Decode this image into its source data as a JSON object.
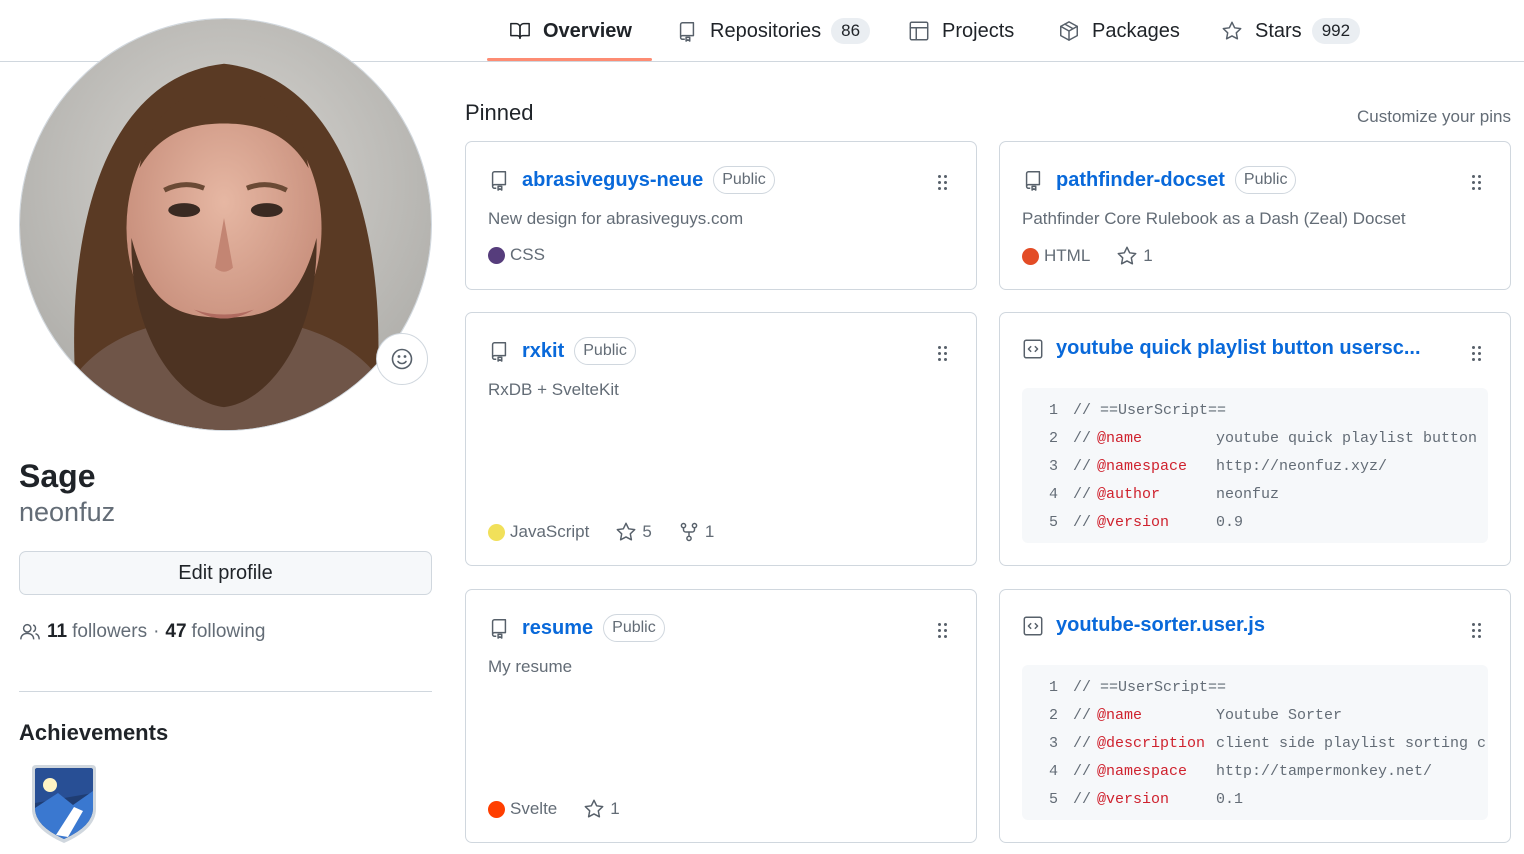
{
  "nav": {
    "tabs": [
      {
        "label": "Overview",
        "icon": "book-icon",
        "active": true
      },
      {
        "label": "Repositories",
        "icon": "repo-icon",
        "count": "86"
      },
      {
        "label": "Projects",
        "icon": "table-icon"
      },
      {
        "label": "Packages",
        "icon": "package-icon"
      },
      {
        "label": "Stars",
        "icon": "star-icon",
        "count": "992"
      }
    ],
    "active_color": "#fd8c73"
  },
  "profile": {
    "display_name": "Sage",
    "username": "neonfuz",
    "edit_label": "Edit profile",
    "followers_count": "11",
    "followers_label": "followers",
    "separator": "·",
    "following_count": "47",
    "following_label": "following",
    "achievements_title": "Achievements"
  },
  "pinned": {
    "title": "Pinned",
    "customize_label": "Customize your pins",
    "cards": [
      {
        "name": "abrasiveguys-neue",
        "visibility": "Public",
        "description": "New design for abrasiveguys.com",
        "language": "CSS",
        "language_color": "#563d7c"
      },
      {
        "name": "pathfinder-docset",
        "visibility": "Public",
        "description": "Pathfinder Core Rulebook as a Dash (Zeal) Docset",
        "language": "HTML",
        "language_color": "#e34c26",
        "stars": "1"
      },
      {
        "name": "rxkit",
        "visibility": "Public",
        "description": "RxDB + SvelteKit",
        "language": "JavaScript",
        "language_color": "#f1e05a",
        "stars": "5",
        "forks": "1"
      },
      {
        "name": "youtube quick playlist button usersc...",
        "type": "gist",
        "code": [
          {
            "n": "1",
            "comment": "// ==UserScript==",
            "key": "",
            "value": ""
          },
          {
            "n": "2",
            "comment": "//",
            "key": "@name",
            "value": "youtube quick playlist button"
          },
          {
            "n": "3",
            "comment": "//",
            "key": "@namespace",
            "value": "http://neonfuz.xyz/"
          },
          {
            "n": "4",
            "comment": "//",
            "key": "@author",
            "value": "neonfuz"
          },
          {
            "n": "5",
            "comment": "//",
            "key": "@version",
            "value": "0.9"
          }
        ]
      },
      {
        "name": "resume",
        "visibility": "Public",
        "description": "My resume",
        "language": "Svelte",
        "language_color": "#ff3e00",
        "stars": "1"
      },
      {
        "name": "youtube-sorter.user.js",
        "type": "gist",
        "code": [
          {
            "n": "1",
            "comment": "// ==UserScript==",
            "key": "",
            "value": ""
          },
          {
            "n": "2",
            "comment": "//",
            "key": "@name",
            "value": "Youtube Sorter"
          },
          {
            "n": "3",
            "comment": "//",
            "key": "@description",
            "value": "client side playlist sorting c"
          },
          {
            "n": "4",
            "comment": "//",
            "key": "@namespace",
            "value": "http://tampermonkey.net/"
          },
          {
            "n": "5",
            "comment": "//",
            "key": "@version",
            "value": "0.1"
          }
        ]
      }
    ]
  }
}
